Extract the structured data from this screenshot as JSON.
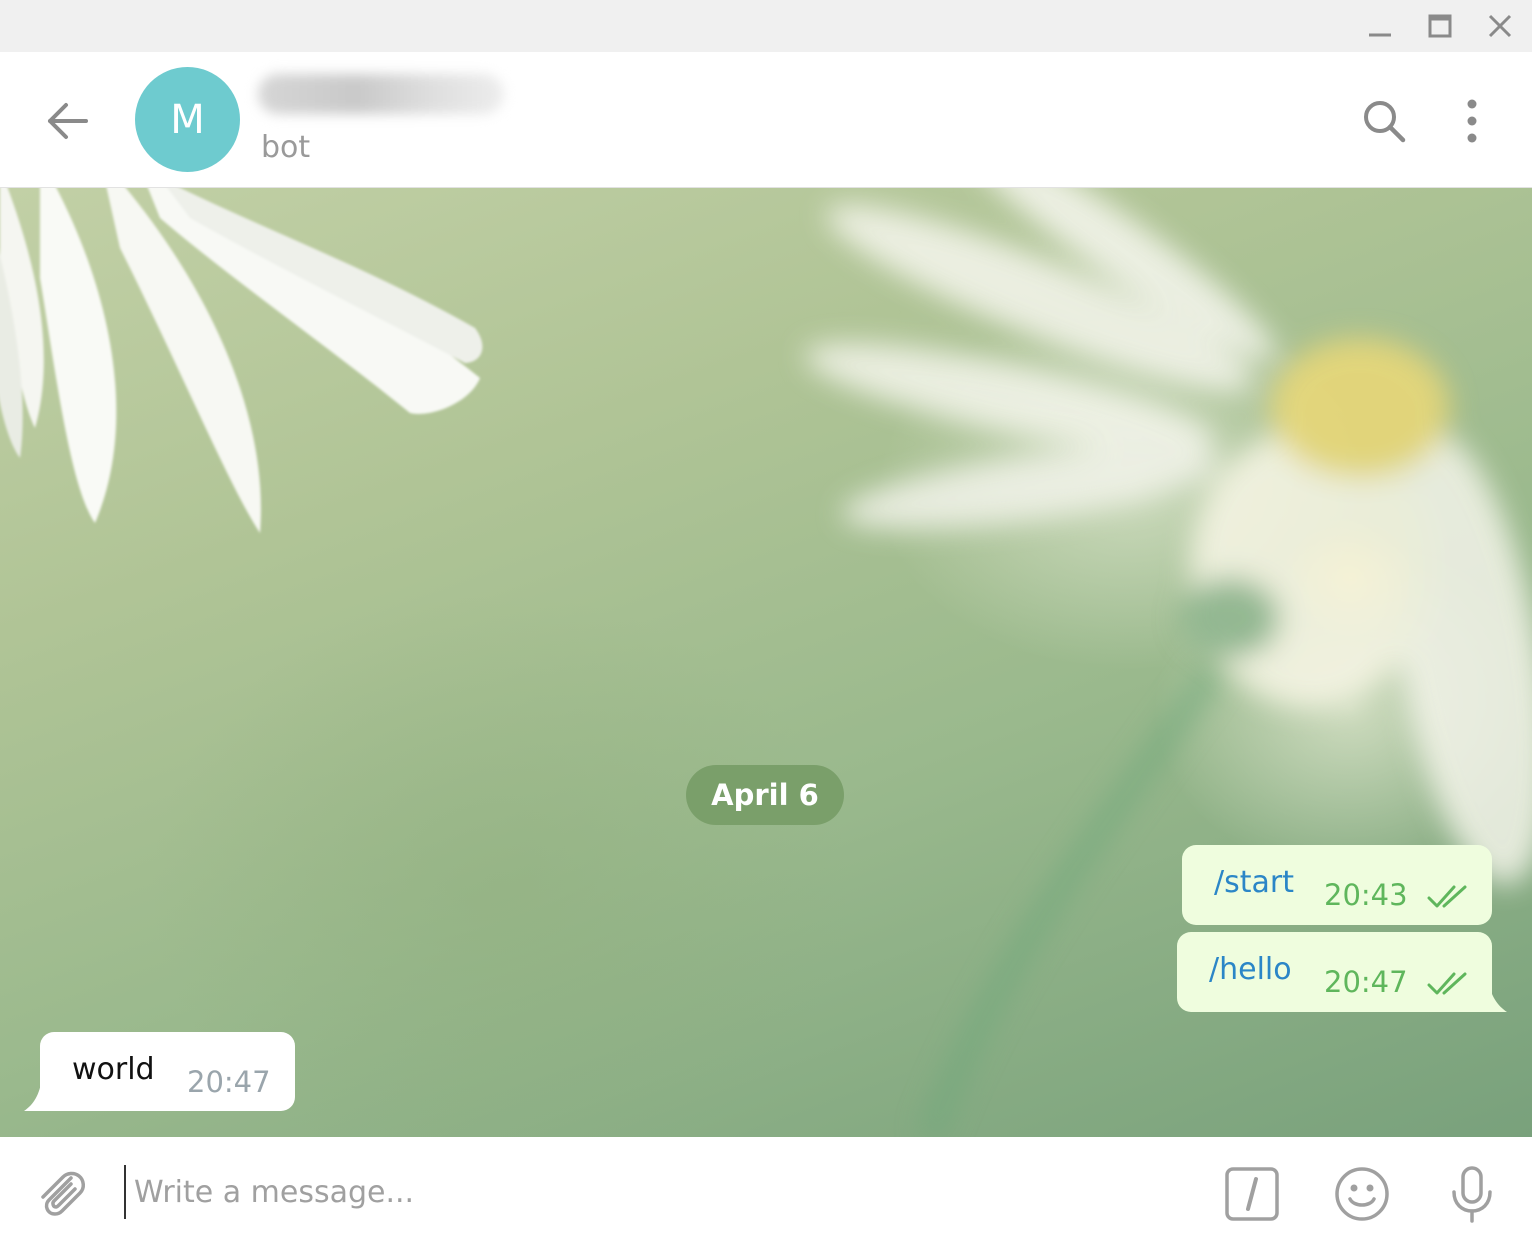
{
  "window": {
    "controls": [
      "minimize-icon",
      "maximize-icon",
      "close-icon"
    ]
  },
  "header": {
    "back_icon": "arrow-left-icon",
    "avatar_letter": "M",
    "avatar_color": "#6ecbcf",
    "chat_name": "",
    "chat_status": "bot",
    "search_icon": "search-icon",
    "more_icon": "more-vertical-icon"
  },
  "chat": {
    "date_divider": "April 6",
    "messages": [
      {
        "direction": "out",
        "text": "/start",
        "time": "20:43",
        "status": "read"
      },
      {
        "direction": "out",
        "text": "/hello",
        "time": "20:47",
        "status": "read"
      },
      {
        "direction": "in",
        "text": "world",
        "time": "20:47"
      }
    ]
  },
  "composer": {
    "placeholder": "Write a message...",
    "value": "",
    "icons": [
      "paperclip-icon",
      "bot-command-icon",
      "emoji-icon",
      "microphone-icon"
    ]
  },
  "colors": {
    "outgoing_bubble": "#effdde",
    "incoming_bubble": "#ffffff",
    "command_link": "#2b86c7",
    "outgoing_time": "#5fb65c",
    "incoming_time": "#9aa5ac",
    "date_pill": "#7a9f6a"
  }
}
